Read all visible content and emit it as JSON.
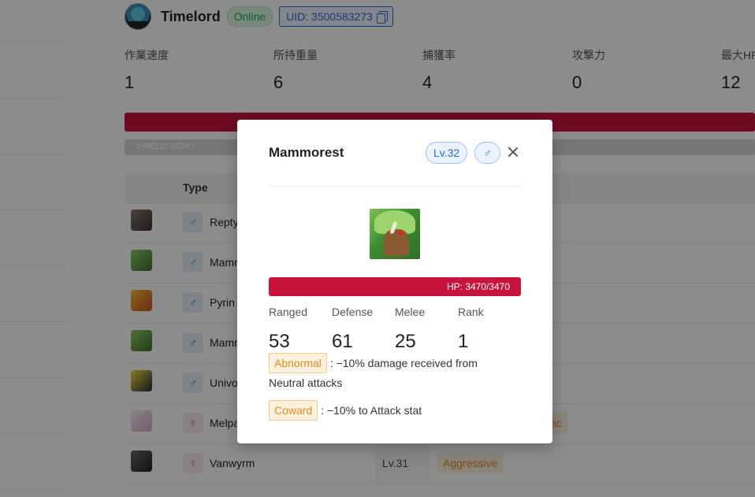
{
  "player": {
    "name": "Timelord",
    "status": "Online",
    "uid_label": "UID: 3500583273"
  },
  "stats": [
    {
      "label": "作業速度",
      "value": "1"
    },
    {
      "label": "所持重量",
      "value": "6"
    },
    {
      "label": "捕獲率",
      "value": "4"
    },
    {
      "label": "攻撃力",
      "value": "0"
    },
    {
      "label": "最大HP",
      "value": "12"
    }
  ],
  "shield": "SHIELD: 0/260",
  "table": {
    "type_header": "Type",
    "rows": [
      {
        "gender": "♂",
        "name": "Repty",
        "level": "",
        "skill": ""
      },
      {
        "gender": "♂",
        "name": "Mamm",
        "level": "",
        "skill": ""
      },
      {
        "gender": "♂",
        "name": "Pyrin",
        "level": "",
        "skill": ""
      },
      {
        "gender": "♂",
        "name": "Mamm",
        "level": "",
        "skill": ""
      },
      {
        "gender": "♂",
        "name": "Univo",
        "level": "",
        "skill": ""
      },
      {
        "gender": "♀",
        "name": "Melpa",
        "level": "",
        "skill": "iac"
      },
      {
        "gender": "♀",
        "name": "Vanwyrm",
        "level": "Lv.31",
        "skill": "Aggressive"
      }
    ]
  },
  "modal": {
    "title": "Mammorest",
    "level": "Lv.32",
    "gender": "♂",
    "hp_text": "HP: 3470/3470",
    "stats": [
      {
        "label": "Ranged",
        "value": "53"
      },
      {
        "label": "Defense",
        "value": "61"
      },
      {
        "label": "Melee",
        "value": "25"
      },
      {
        "label": "Rank",
        "value": "1"
      }
    ],
    "passives": [
      {
        "tag": "Abnormal",
        "desc_line1": ": −10% damage received from",
        "desc_line2": "Neutral attacks"
      },
      {
        "tag": "Coward",
        "desc_line1": ": −10% to Attack stat",
        "desc_line2": ""
      }
    ]
  },
  "colors": {
    "hp_bar": "#c8143c",
    "accent": "#2b6cd8",
    "online": "#2aa05a",
    "skill_tag": "#e08a1e"
  }
}
